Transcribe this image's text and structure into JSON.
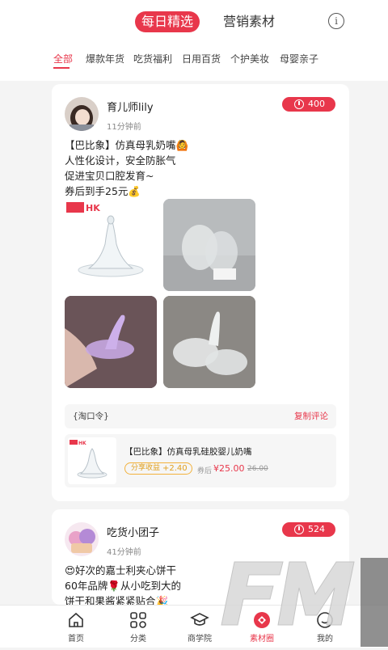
{
  "header": {
    "tabs": [
      {
        "label": "每日精选"
      },
      {
        "label": "营销素材"
      }
    ],
    "info_icon_glyph": "i"
  },
  "categories": [
    {
      "label": "全部"
    },
    {
      "label": "爆款年货"
    },
    {
      "label": "吃货福利"
    },
    {
      "label": "日用百货"
    },
    {
      "label": "个护美妆"
    },
    {
      "label": "母婴亲子"
    }
  ],
  "posts": [
    {
      "user": "育儿师lily",
      "time": "11分钟前",
      "count": "400",
      "text": "【巴比象】仿真母乳奶嘴🙆\n人性化设计，安全防胀气\n促进宝贝口腔发育~\n券后到手25元💰",
      "brand_badge": "HK",
      "taokou_label": "{淘口令}",
      "copy_label": "复制评论",
      "product": {
        "title": "【巴比象】仿真母乳硅胶婴儿奶嘴",
        "share_label": "分享收益",
        "share_value": "+2.40",
        "after_label": "券后",
        "price": "¥25.00",
        "original_price": "26.00"
      }
    },
    {
      "user": "吃货小团子",
      "time": "41分钟前",
      "count": "524",
      "text": "😍好次的嘉士利夹心饼干\n60年品牌🌹从小吃到大的\n饼干和果酱紧紧贴合🎉"
    }
  ],
  "bottom_nav": [
    {
      "label": "首页",
      "icon": "home-icon"
    },
    {
      "label": "分类",
      "icon": "grid-icon"
    },
    {
      "label": "商学院",
      "icon": "graduation-cap-icon"
    },
    {
      "label": "素材圈",
      "icon": "material-circle-icon"
    },
    {
      "label": "我的",
      "icon": "profile-icon"
    }
  ],
  "colors": {
    "accent": "#e8374b",
    "gold": "#f2b23d"
  }
}
